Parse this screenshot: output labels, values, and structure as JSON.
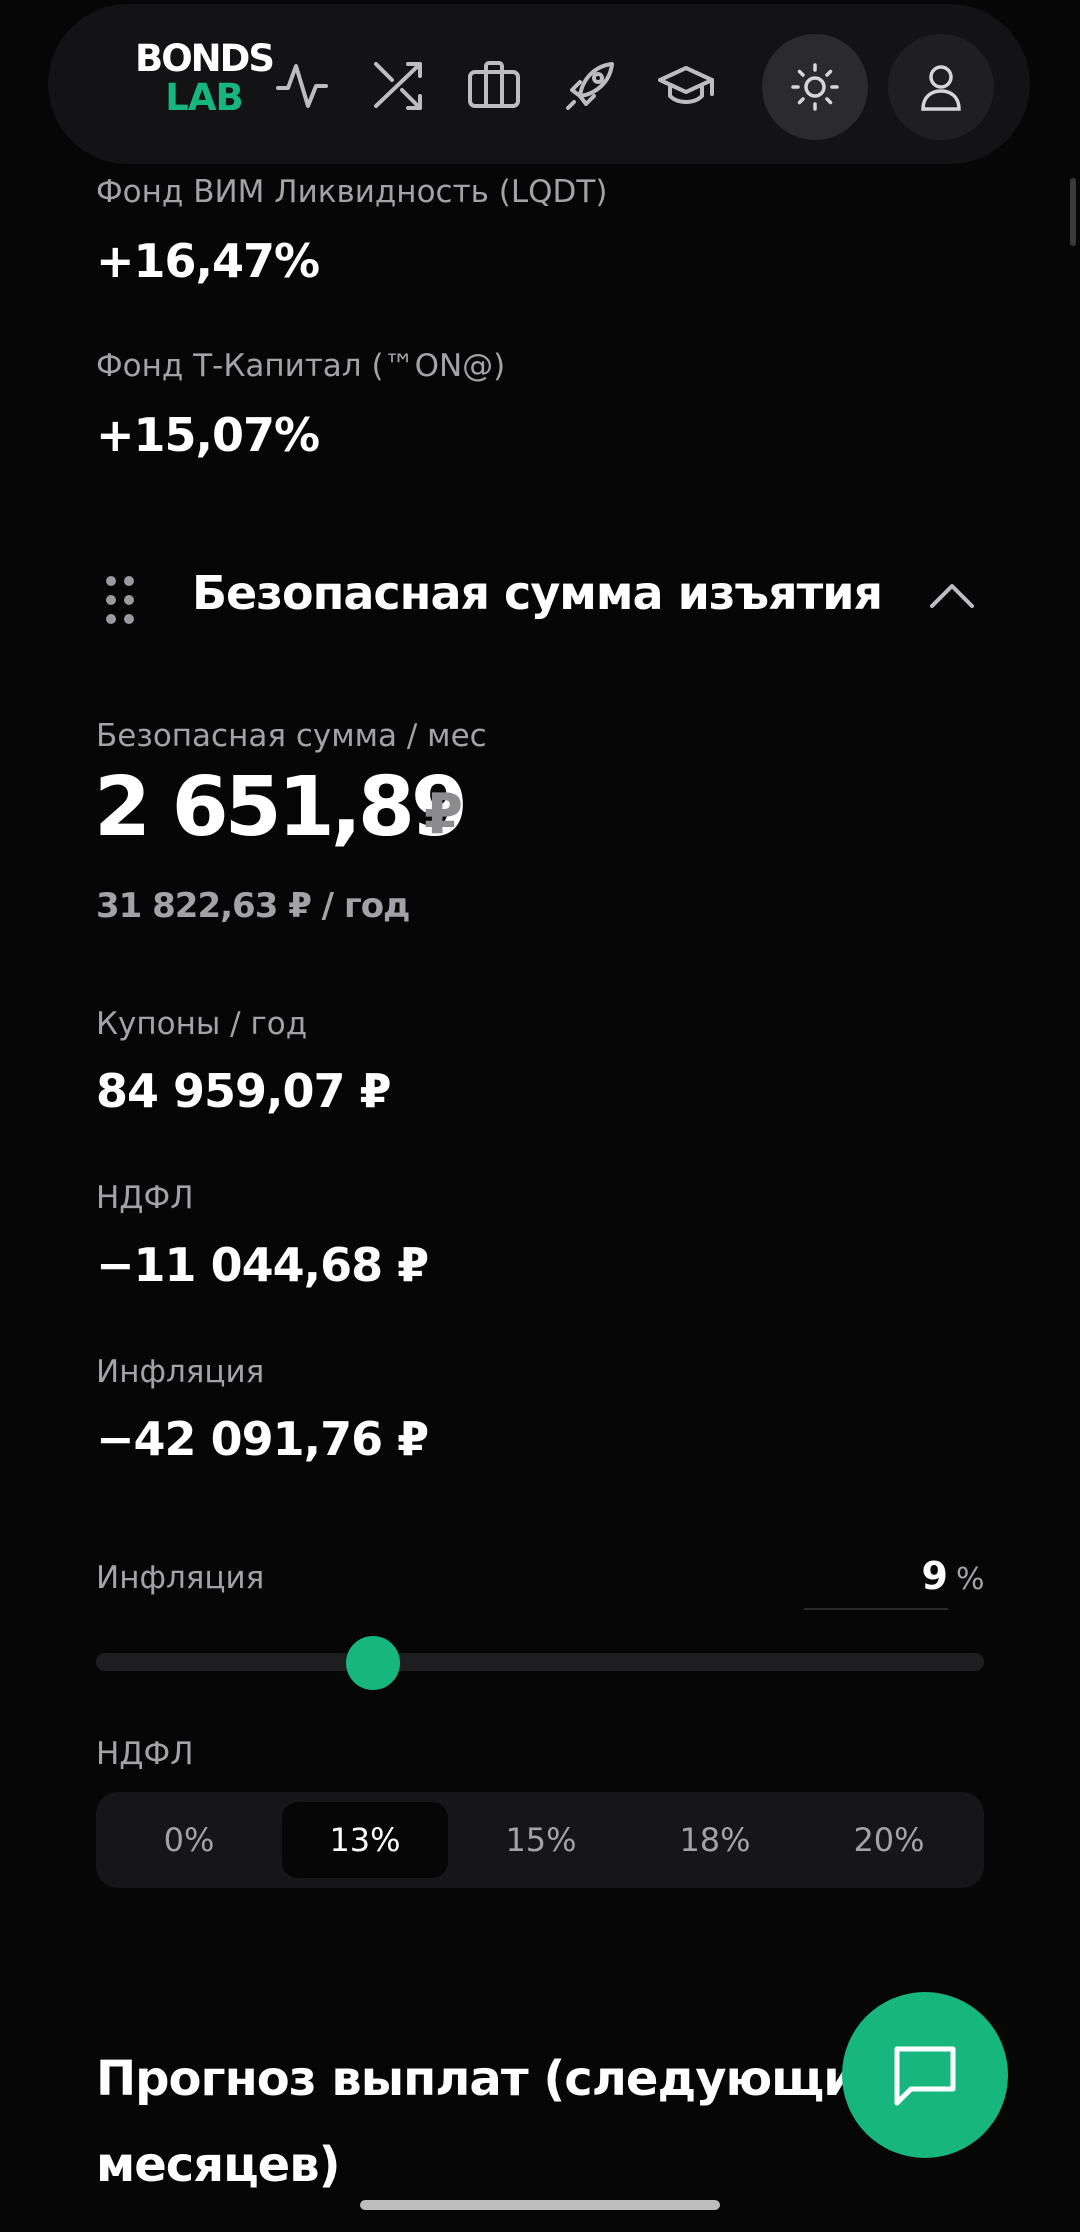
{
  "header": {
    "logo_top": "BONDS",
    "logo_bottom": "LAB",
    "icons": [
      "activity-icon",
      "shuffle-icon",
      "briefcase-icon",
      "rocket-icon",
      "graduation-cap-icon",
      "sun-icon",
      "user-icon"
    ]
  },
  "funds": [
    {
      "name": "Фонд ВИМ Ликвидность (LQDT)",
      "value": "+16,47%"
    },
    {
      "name": "Фонд Т-Капитал (™ON@)",
      "value": "+15,07%"
    }
  ],
  "swr": {
    "title": "Безопасная сумма изъятия",
    "monthly_label": "Безопасная сумма / мес",
    "monthly_amount": "2 651,89",
    "currency": "₽",
    "yearly_line": "31 822,63 ₽ / год",
    "coupons_label": "Купоны / год",
    "coupons_value": "84 959,07 ₽",
    "ndfl_label": "НДФЛ",
    "ndfl_value": "−11 044,68 ₽",
    "inflation_label": "Инфляция",
    "inflation_value": "−42 091,76 ₽"
  },
  "controls": {
    "inflation_label": "Инфляция",
    "inflation_input": "9",
    "inflation_unit": "%",
    "inflation_slider_fraction": 0.3,
    "ndfl_label": "НДФЛ",
    "ndfl_options": [
      "0%",
      "13%",
      "15%",
      "18%",
      "20%"
    ],
    "ndfl_selected": "13%"
  },
  "forecast": {
    "title": "Прогноз выплат (следующие 12 месяцев)"
  },
  "colors": {
    "accent": "#17b67f",
    "background": "#060607"
  }
}
